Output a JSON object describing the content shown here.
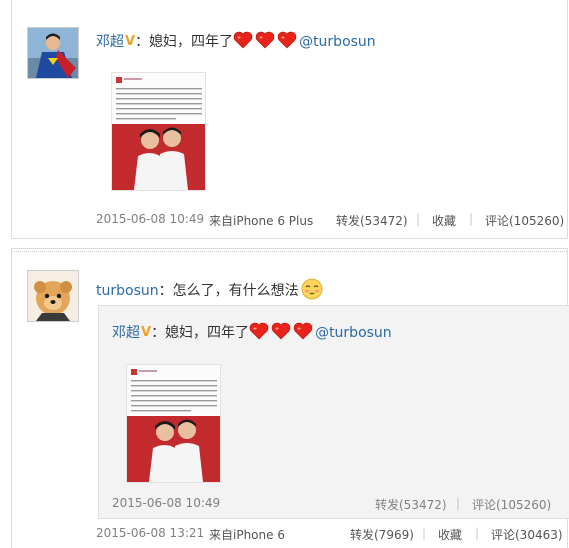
{
  "post1": {
    "author": "邓超",
    "colon": "：",
    "text": "媳妇，四年了",
    "mention": "@turbosun",
    "time": "2015-06-08 10:49",
    "source": "来自iPhone 6 Plus",
    "actions": {
      "repost": "转发(53472)",
      "favorite": "收藏",
      "comment": "评论(105260)"
    }
  },
  "post2": {
    "author": "turbosun",
    "colon": "：",
    "text": "怎么了，有什么想法",
    "time": "2015-06-08 13:21",
    "source": "来自iPhone 6",
    "actions": {
      "repost": "转发(7969)",
      "favorite": "收藏",
      "comment": "评论(30463)"
    },
    "quoted": {
      "author": "邓超",
      "colon": "：",
      "text": "媳妇，四年了",
      "mention": "@turbosun",
      "time": "2015-06-08 10:49",
      "actions": {
        "repost": "转发(53472)",
        "comment": "评论(105260)"
      }
    }
  },
  "separator": "|",
  "colors": {
    "link": "#2b6aa8",
    "badge": "#f0a020",
    "heart": "#e8231a",
    "photo_bg": "#c32a2e"
  },
  "icons": [
    "superman-avatar-icon",
    "dog-avatar-icon",
    "v-badge-icon",
    "heart-emoji-icon",
    "shy-face-emoji-icon"
  ]
}
